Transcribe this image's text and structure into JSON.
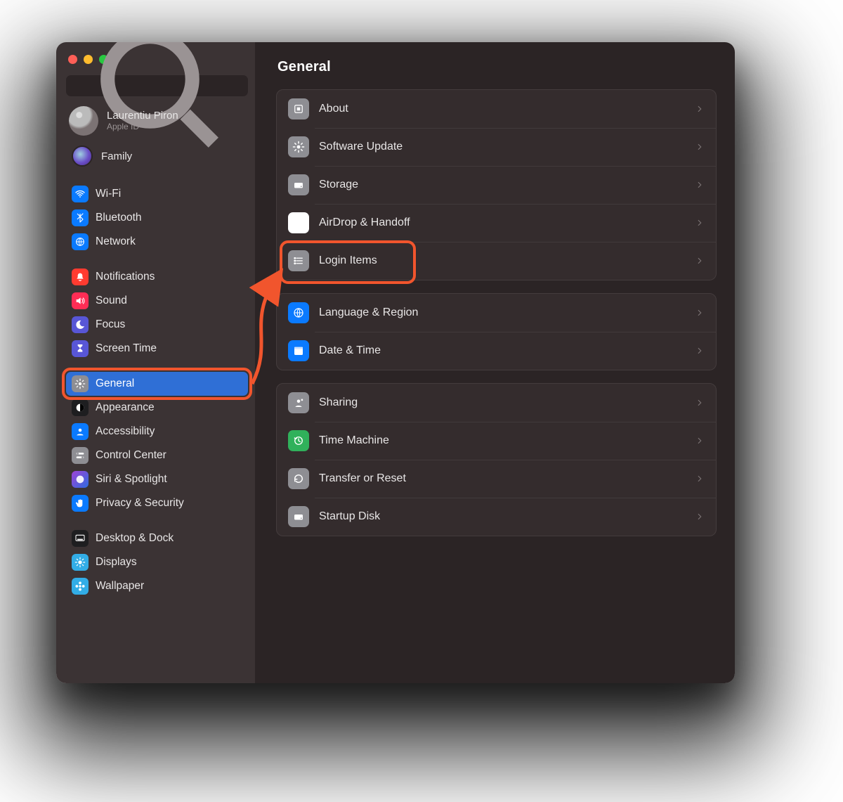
{
  "search": {
    "placeholder": "Search"
  },
  "account": {
    "name": "Laurentiu Piron",
    "sub": "Apple ID"
  },
  "family": {
    "label": "Family"
  },
  "sidebar": {
    "groups": [
      {
        "items": [
          {
            "id": "wifi",
            "label": "Wi-Fi",
            "icon": "wifi",
            "bg": "bg-blue"
          },
          {
            "id": "bluetooth",
            "label": "Bluetooth",
            "icon": "bluetooth",
            "bg": "bg-blue"
          },
          {
            "id": "network",
            "label": "Network",
            "icon": "globe",
            "bg": "bg-blue"
          }
        ]
      },
      {
        "items": [
          {
            "id": "notifications",
            "label": "Notifications",
            "icon": "bell",
            "bg": "bg-red"
          },
          {
            "id": "sound",
            "label": "Sound",
            "icon": "speaker",
            "bg": "bg-pink"
          },
          {
            "id": "focus",
            "label": "Focus",
            "icon": "moon",
            "bg": "bg-indigo"
          },
          {
            "id": "screentime",
            "label": "Screen Time",
            "icon": "hourglass",
            "bg": "bg-indigo"
          }
        ]
      },
      {
        "items": [
          {
            "id": "general",
            "label": "General",
            "icon": "gear",
            "bg": "bg-gray",
            "selected": true
          },
          {
            "id": "appearance",
            "label": "Appearance",
            "icon": "appearance",
            "bg": "bg-black"
          },
          {
            "id": "accessibility",
            "label": "Accessibility",
            "icon": "person",
            "bg": "bg-blue"
          },
          {
            "id": "controlcenter",
            "label": "Control Center",
            "icon": "switches",
            "bg": "bg-gray"
          },
          {
            "id": "siri",
            "label": "Siri & Spotlight",
            "icon": "siri",
            "bg": "bg-purple"
          },
          {
            "id": "privacy",
            "label": "Privacy & Security",
            "icon": "hand",
            "bg": "bg-blue"
          }
        ]
      },
      {
        "items": [
          {
            "id": "desktop",
            "label": "Desktop & Dock",
            "icon": "dock",
            "bg": "bg-black"
          },
          {
            "id": "displays",
            "label": "Displays",
            "icon": "sun",
            "bg": "bg-cyan"
          },
          {
            "id": "wallpaper",
            "label": "Wallpaper",
            "icon": "flower",
            "bg": "bg-cyan"
          }
        ]
      }
    ]
  },
  "page": {
    "title": "General"
  },
  "content": {
    "groups": [
      {
        "rows": [
          {
            "id": "about",
            "label": "About",
            "icon": "chip",
            "bg": "rg-gray"
          },
          {
            "id": "swupdate",
            "label": "Software Update",
            "icon": "gear",
            "bg": "rg-gray"
          },
          {
            "id": "storage",
            "label": "Storage",
            "icon": "drive",
            "bg": "rg-gray"
          },
          {
            "id": "airdrop",
            "label": "AirDrop & Handoff",
            "icon": "airdrop",
            "bg": "rg-blue",
            "white": true
          },
          {
            "id": "login",
            "label": "Login Items",
            "icon": "list",
            "bg": "rg-gray",
            "highlighted": true
          }
        ]
      },
      {
        "rows": [
          {
            "id": "language",
            "label": "Language & Region",
            "icon": "globe",
            "bg": "rg-blue"
          },
          {
            "id": "datetime",
            "label": "Date & Time",
            "icon": "calendar",
            "bg": "rg-blue"
          }
        ]
      },
      {
        "rows": [
          {
            "id": "sharing",
            "label": "Sharing",
            "icon": "share",
            "bg": "rg-gray"
          },
          {
            "id": "timemachine",
            "label": "Time Machine",
            "icon": "clockcw",
            "bg": "rg-green"
          },
          {
            "id": "transfer",
            "label": "Transfer or Reset",
            "icon": "ccw",
            "bg": "rg-gray"
          },
          {
            "id": "startup",
            "label": "Startup Disk",
            "icon": "drive",
            "bg": "rg-gray"
          }
        ]
      }
    ]
  },
  "annotations": {
    "highlight_color": "#f1552d",
    "sidebar_highlight": "general",
    "content_highlight": "login"
  }
}
